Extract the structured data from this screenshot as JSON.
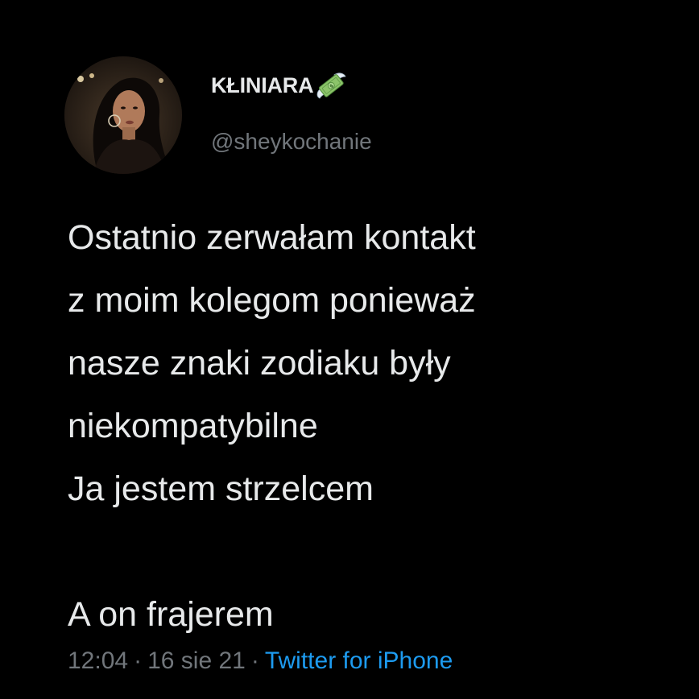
{
  "user": {
    "display_name": "KŁINIARA",
    "name_emoji_icon": "money-with-wings-icon",
    "handle": "@sheykochanie",
    "avatar_icon": "profile-photo"
  },
  "tweet": {
    "lines": [
      "Ostatnio zerwałam kontakt",
      "z moim kolegom ponieważ",
      "nasze znaki zodiaku były",
      "niekompatybilne",
      "Ja jestem strzelcem",
      "A on frajerem"
    ]
  },
  "meta": {
    "time": "12:04",
    "separator": "·",
    "date": "16 sie 21",
    "source": "Twitter for iPhone"
  },
  "colors": {
    "background": "#000000",
    "text": "#e7e9ea",
    "secondary": "#71767b",
    "link": "#1d9bf0"
  }
}
